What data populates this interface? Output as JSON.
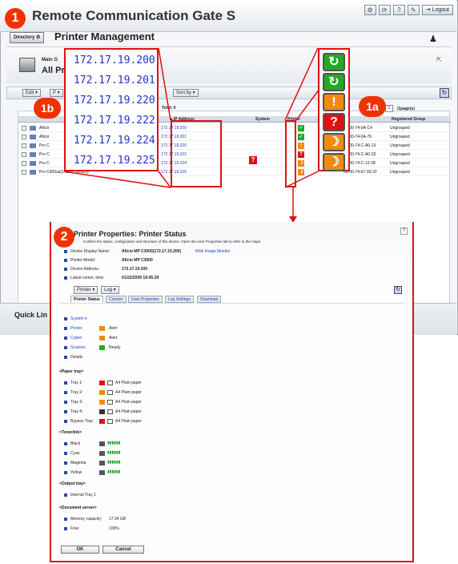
{
  "window": {
    "app_title": "Remote Communication Gate S",
    "directory_btn": "Directory",
    "page_title": "Printer Management",
    "logout": "Logout",
    "header_icons": [
      "gear-icon",
      "refresh-icon",
      "help-icon",
      "tools-icon"
    ]
  },
  "group": {
    "label": "Main G",
    "title": "All Pr"
  },
  "toolbar": {
    "edit": "Edit",
    "p": "P",
    "sort": "Sort by",
    "selected": "Total: 0",
    "page_value": "1",
    "page_label": "/1page(s)"
  },
  "table": {
    "headers": {
      "ip": "IP Address",
      "system": "System",
      "printer": "Printer",
      "group": "Registered Group"
    },
    "rows": [
      {
        "name": "Aficio",
        "ip": "172.17.19.200",
        "mac": "00-00-74-0A-C4",
        "group": "Ungrouped",
        "status": "ok"
      },
      {
        "name": "Aficio",
        "ip": "172.17.19.201",
        "mac": "00-00-74-0A-76",
        "group": "Ungrouped",
        "status": "ok"
      },
      {
        "name": "Pro C",
        "ip": "172.17.19.220",
        "mac": "00-00-74-C-A0-13",
        "group": "Ungrouped",
        "status": "alert"
      },
      {
        "name": "Pro C",
        "ip": "172.17.19.222",
        "mac": "00-00-74-C-A0-23",
        "group": "Ungrouped",
        "status": "error"
      },
      {
        "name": "Pro C",
        "ip": "172.17.19.224",
        "mac": "00-00-74-C-12-38",
        "group": "Ungrouped",
        "status": "warn"
      },
      {
        "name": "Pro C900sa(172.17.19.225)",
        "ip": "172.17.19.225",
        "mac": "00-00-74-67-33-22",
        "group": "Ungrouped",
        "status": "warn"
      }
    ]
  },
  "quick_links": "Quick Lin",
  "zoom_ips": [
    "172.17.19.200",
    "172.17.19.201",
    "172.17.19.220",
    "172.17.19.222",
    "172.17.19.224",
    "172.17.19.225"
  ],
  "zoom_status": [
    {
      "glyph": "↻",
      "color": "#22aa22"
    },
    {
      "glyph": "↻",
      "color": "#22aa22"
    },
    {
      "glyph": "!",
      "color": "#f08a10"
    },
    {
      "glyph": "?",
      "color": "#dd1111"
    },
    {
      "glyph": "☽",
      "color": "#f08a10"
    },
    {
      "glyph": "☽",
      "color": "#f08a10"
    }
  ],
  "badges": {
    "b1": "1",
    "b1a": "1a",
    "b1b": "1b",
    "b2": "2"
  },
  "dialog": {
    "title": "Printer Properties: Printer Status",
    "help": "?",
    "description": "Confirm the status, configuration and structure of this device. Open the User Properties tab to refer to the maps.",
    "display_name_label": "Device Display Name:",
    "display_name": "Aficio MP C3000(172.17.19.200)",
    "web_image_monitor": "Web Image Monitor",
    "model_label": "Printer Model:",
    "model": "Aficio MP C3000",
    "address_label": "Device Address:",
    "address": "172.17.19.200",
    "comm_label": "Latest comm. time:",
    "comm_time": "01/22/2009 18:45:29",
    "printer_dd": "Printer",
    "log_dd": "Log",
    "tabs": [
      "Printer Status",
      "Counter",
      "User Properties",
      "Log Settings",
      "Download"
    ],
    "system_label": "System",
    "status_rows": [
      {
        "label": "Printer",
        "status": "Alert",
        "color": "#f08a10"
      },
      {
        "label": "Copier",
        "status": "Alert",
        "color": "#f08a10"
      },
      {
        "label": "Scanner",
        "status": "Ready",
        "color": "#22aa22"
      }
    ],
    "details": "Details",
    "paper_section": "<Paper tray>",
    "trays": [
      {
        "label": "Tray 1:",
        "paper": "A4 Plain paper",
        "color": "#dd1111"
      },
      {
        "label": "Tray 2:",
        "paper": "A4 Plain paper",
        "color": "#f08a10"
      },
      {
        "label": "Tray 3:",
        "paper": "A4 Plain paper",
        "color": "#f08a10"
      },
      {
        "label": "Tray 4:",
        "paper": "A4 Plain paper",
        "color": "#333333"
      },
      {
        "label": "Bypass Tray:",
        "paper": "A4 Plain paper",
        "color": "#dd1111"
      }
    ],
    "toner_section": "<Toner/Ink>",
    "toners": [
      {
        "label": "Black",
        "level": "▮▮▮▮▮▮"
      },
      {
        "label": "Cyan",
        "level": "▮▮▮▮▮▮"
      },
      {
        "label": "Magenta",
        "level": "▮▮▮▮▮▮"
      },
      {
        "label": "Yellow",
        "level": "▮▮▮▮▮▮"
      }
    ],
    "output_section": "<Output tray>",
    "output_tray": "Internal Tray 1",
    "storage_section": "<Document server>",
    "capacity_label": "Memory capacity:",
    "capacity": "17.04 GB",
    "free_label": "Free:",
    "free": "100%",
    "ok": "OK",
    "cancel": "Cancel"
  },
  "colors": {
    "red_frame": "#e01010",
    "badge": "#ee3300",
    "link": "#2233cc"
  }
}
